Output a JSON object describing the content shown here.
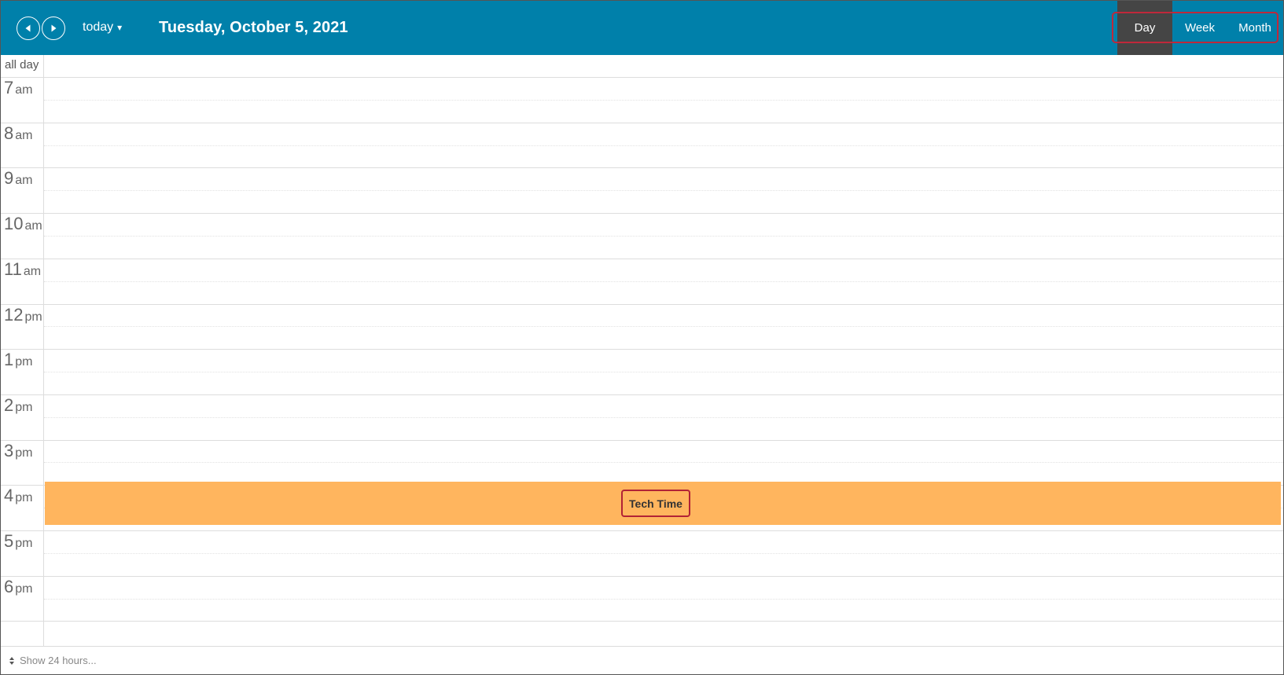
{
  "toolbar": {
    "prev_icon": "triangle-left-icon",
    "next_icon": "triangle-right-icon",
    "today_label": "today",
    "today_caret": "▾",
    "title": "Tuesday, October 5, 2021",
    "views": [
      {
        "label": "Day",
        "active": true
      },
      {
        "label": "Week",
        "active": false
      },
      {
        "label": "Month",
        "active": false
      }
    ]
  },
  "grid": {
    "allday_label": "all day",
    "hours": [
      {
        "num": "7",
        "suffix": "am"
      },
      {
        "num": "8",
        "suffix": "am"
      },
      {
        "num": "9",
        "suffix": "am"
      },
      {
        "num": "10",
        "suffix": "am"
      },
      {
        "num": "11",
        "suffix": "am"
      },
      {
        "num": "12",
        "suffix": "pm"
      },
      {
        "num": "1",
        "suffix": "pm"
      },
      {
        "num": "2",
        "suffix": "pm"
      },
      {
        "num": "3",
        "suffix": "pm"
      },
      {
        "num": "4",
        "suffix": "pm"
      },
      {
        "num": "5",
        "suffix": "pm"
      },
      {
        "num": "6",
        "suffix": "pm"
      }
    ]
  },
  "event": {
    "title": "Tech Time",
    "color": "#ffb55e"
  },
  "footer": {
    "toggle_label": "Show 24 hours...",
    "toggle_icon": "updown-arrows-icon"
  },
  "colors": {
    "header_bg": "#0080aa",
    "active_view_bg": "#454545",
    "highlight_border": "#c0283a"
  }
}
